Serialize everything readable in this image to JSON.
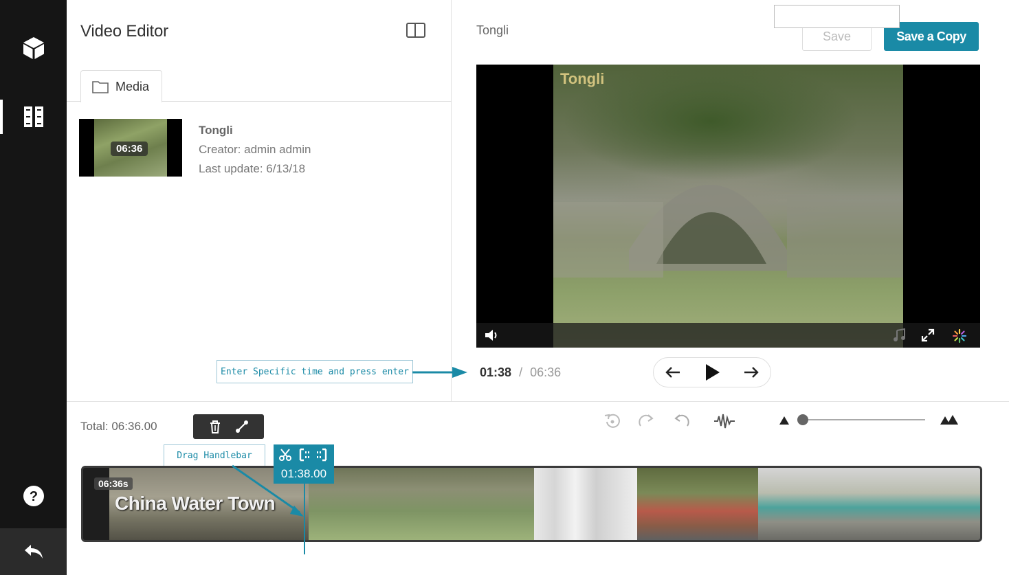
{
  "sidebar": {
    "items": [
      {
        "icon": "cube-icon"
      },
      {
        "icon": "video-editor-icon",
        "active": true
      }
    ],
    "bottom": [
      {
        "icon": "help-icon"
      },
      {
        "icon": "back-arrow-icon"
      }
    ]
  },
  "left_panel": {
    "title": "Video Editor",
    "layout_toggle_icon": "panel-layout-icon",
    "tabs": [
      {
        "label": "Media",
        "icon": "folder-icon"
      }
    ],
    "media_item": {
      "duration": "06:36",
      "name": "Tongli",
      "creator": "Creator: admin admin",
      "last_update": "Last update: 6/13/18"
    }
  },
  "player": {
    "title": "Tongli",
    "save_label": "Save",
    "save_copy_label": "Save a Copy",
    "watermark": "Tongli",
    "current_time": "01:38",
    "separator": "/",
    "duration": "06:36",
    "controls": [
      "volume-icon",
      "music-icon",
      "fullscreen-icon",
      "loading-icon"
    ],
    "nav": [
      "prev-frame-icon",
      "play-icon",
      "next-frame-icon"
    ]
  },
  "annotations": {
    "time_input_hint": "Enter Specific time and press enter",
    "drag_hint": "Drag Handlebar"
  },
  "timeline": {
    "total": "Total: 06:36.00",
    "clip_tools": [
      "trash-icon",
      "link-icon"
    ],
    "toolbar": [
      "reset-icon",
      "redo-icon",
      "undo-icon",
      "waveform-icon"
    ],
    "zoom_level": 0,
    "clip_duration": "06:36s",
    "clip_title": "China Water Town",
    "cursor_time": "01:38.00",
    "cursor_tools": [
      "scissors-icon",
      "set-in-icon",
      "set-out-icon"
    ],
    "colors": {
      "accent": "#1a8aa6",
      "rail": "#151515"
    }
  }
}
